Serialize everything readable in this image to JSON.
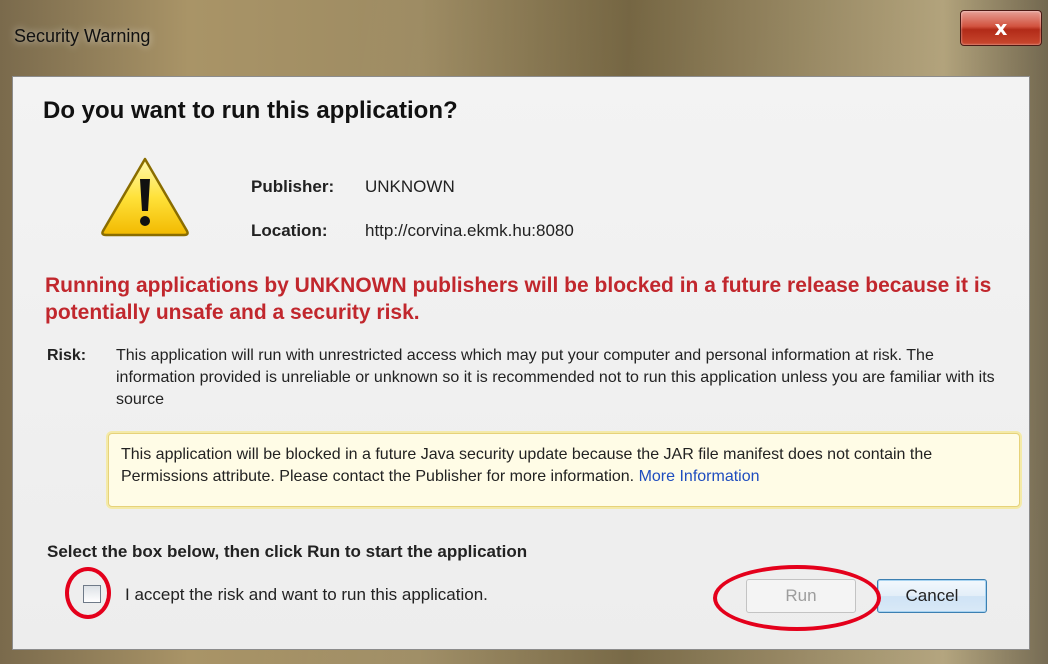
{
  "window": {
    "title": "Security Warning",
    "close_label": "x"
  },
  "dialog": {
    "heading": "Do you want to run this application?",
    "publisher_label": "Publisher:",
    "publisher_value": "UNKNOWN",
    "location_label": "Location:",
    "location_value": "http://corvina.ekmk.hu:8080",
    "warning_message": "Running applications by UNKNOWN publishers will be blocked in a future release because it is potentially unsafe and a security risk.",
    "risk_label": "Risk:",
    "risk_text": "This application will run with unrestricted access which may put your computer and personal information at risk. The information provided is unreliable or unknown so it is recommended not to run this application unless you are familiar with its source",
    "notice_text": "This application will be blocked in a future Java security update because the JAR file manifest does not contain the Permissions attribute. Please contact the Publisher for more information.",
    "notice_link": "More Information",
    "select_heading": "Select the box below, then click Run to start the application",
    "checkbox_label": "I accept the risk and want to run this application.",
    "checkbox_checked": false,
    "run_label": "Run",
    "cancel_label": "Cancel"
  },
  "colors": {
    "warning_red": "#c1272d",
    "highlight_red": "#e4001b",
    "link_blue": "#1f4dbf"
  },
  "icons": {
    "warning": "warning-triangle-icon",
    "close": "close-icon"
  }
}
